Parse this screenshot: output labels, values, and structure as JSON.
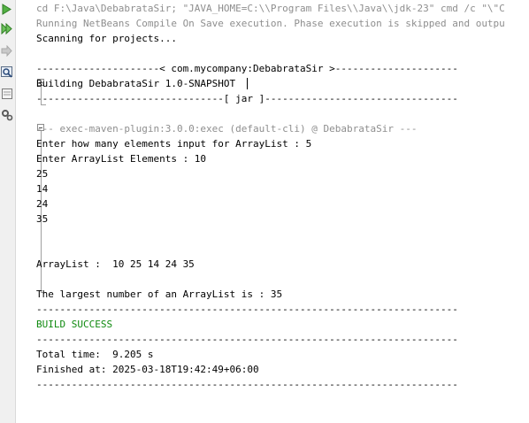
{
  "toolbar": {
    "buttons": [
      "rerun-icon",
      "rerun-with-options-icon",
      "stop-icon",
      "find-icon",
      "settings-icon"
    ]
  },
  "output": {
    "lines": [
      {
        "text": "cd F:\\Java\\DebabrataSir; \"JAVA_HOME=C:\\\\Program Files\\\\Java\\\\jdk-23\" cmd /c \"\\\"C",
        "style": "gray"
      },
      {
        "text": "Running NetBeans Compile On Save execution. Phase execution is skipped and outpu",
        "style": "gray"
      },
      {
        "text": "Scanning for projects...",
        "style": "normal"
      },
      {
        "text": "",
        "style": "normal"
      },
      {
        "text": "---------------------< com.mycompany:DebabrataSir >---------------------",
        "style": "normal"
      },
      {
        "text": "Building DebabrataSir 1.0-SNAPSHOT",
        "style": "normal"
      },
      {
        "text": "--------------------------------[ jar ]---------------------------------",
        "style": "normal"
      },
      {
        "text": "",
        "style": "normal"
      },
      {
        "text": "--- exec-maven-plugin:3.0.0:exec (default-cli) @ DebabrataSir ---",
        "style": "gray"
      },
      {
        "text": "Enter how many elements input for ArrayList : 5",
        "style": "normal"
      },
      {
        "text": "Enter ArrayList Elements : 10",
        "style": "normal"
      },
      {
        "text": "25",
        "style": "normal"
      },
      {
        "text": "14",
        "style": "normal"
      },
      {
        "text": "24",
        "style": "normal"
      },
      {
        "text": "35",
        "style": "normal"
      },
      {
        "text": "",
        "style": "normal"
      },
      {
        "text": "",
        "style": "normal"
      },
      {
        "text": "ArrayList :  10 25 14 24 35",
        "style": "normal"
      },
      {
        "text": "",
        "style": "normal"
      },
      {
        "text": "The largest number of an ArrayList is : 35",
        "style": "normal"
      },
      {
        "text": "------------------------------------------------------------------------",
        "style": "normal"
      },
      {
        "text": "BUILD SUCCESS",
        "style": "green"
      },
      {
        "text": "------------------------------------------------------------------------",
        "style": "normal"
      },
      {
        "text": "Total time:  9.205 s",
        "style": "normal"
      },
      {
        "text": "Finished at: 2025-03-18T19:42:49+06:00",
        "style": "normal"
      },
      {
        "text": "------------------------------------------------------------------------",
        "style": "normal"
      }
    ]
  }
}
